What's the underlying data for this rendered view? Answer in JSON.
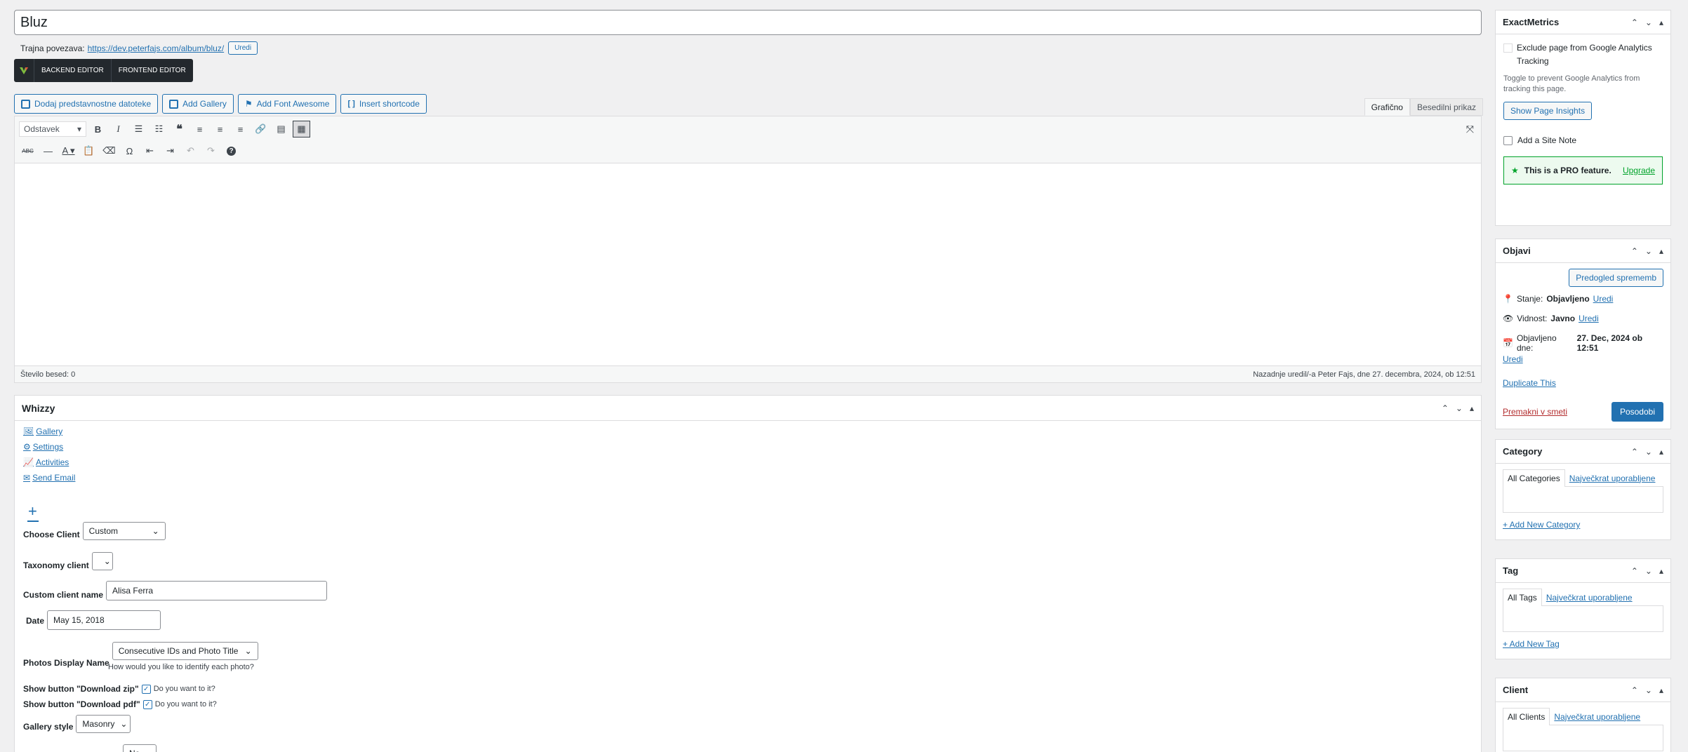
{
  "title": {
    "value": "Bluz"
  },
  "permalink": {
    "label": "Trajna povezava:",
    "url": "https://dev.peterfajs.com/album/bluz/",
    "edit": "Uredi"
  },
  "vc": {
    "backend": "BACKEND EDITOR",
    "frontend": "FRONTEND EDITOR"
  },
  "media_buttons": [
    "Dodaj predstavnostne datoteke",
    "Add Gallery",
    "Add Font Awesome",
    "Insert shortcode"
  ],
  "editor_tabs": {
    "visual": "Grafično",
    "text": "Besedilni prikaz"
  },
  "toolbar": {
    "format": "Odstavek"
  },
  "status": {
    "words": "Število besed: 0",
    "last_edit": "Nazadnje uredil/-a Peter Fajs, dne 27. decembra, 2024, ob 12:51"
  },
  "whizzy": {
    "title": "Whizzy",
    "links": [
      "Gallery",
      "Settings",
      "Activities",
      "Send Email"
    ],
    "plus": "+",
    "choose_client": {
      "label": "Choose Client",
      "value": "Custom"
    },
    "taxonomy_client": {
      "label": "Taxonomy client",
      "value": ""
    },
    "custom_client": {
      "label": "Custom client name",
      "value": "Alisa Ferra"
    },
    "date": {
      "label": "Date",
      "value": "May 15, 2018"
    },
    "photos_display": {
      "label": "Photos Display Name",
      "value": "Consecutive IDs and Photo Title",
      "hint": "How would you like to identify each photo?"
    },
    "download_zip": {
      "label": "Show button \"Download zip\"",
      "hint": "Do you want to it?"
    },
    "download_pdf": {
      "label": "Show button \"Download pdf\"",
      "hint": "Do you want to it?"
    },
    "gallery_style": {
      "label": "Gallery style",
      "value": "Masonry"
    },
    "partial_select": "No"
  },
  "exactmetrics": {
    "title": "ExactMetrics",
    "exclude": "Exclude page from Google Analytics Tracking",
    "toggle_desc": "Toggle to prevent Google Analytics from tracking this page.",
    "insights": "Show Page Insights",
    "site_note": "Add a Site Note",
    "pro": "This is a PRO feature.",
    "upgrade": "Upgrade"
  },
  "publish": {
    "title": "Objavi",
    "preview": "Predogled sprememb",
    "status_label": "Stanje:",
    "status_value": "Objavljeno",
    "status_edit": "Uredi",
    "visibility_label": "Vidnost:",
    "visibility_value": "Javno",
    "visibility_edit": "Uredi",
    "published_label": "Objavljeno dne:",
    "published_value": "27. Dec, 2024 ob 12:51",
    "published_edit": "Uredi",
    "duplicate": "Duplicate This",
    "trash": "Premakni v smeti",
    "update": "Posodobi"
  },
  "category": {
    "title": "Category",
    "tab_all": "All Categories",
    "tab_popular": "Največkrat uporabljene",
    "add": "+ Add New Category"
  },
  "tag": {
    "title": "Tag",
    "tab_all": "All Tags",
    "tab_popular": "Največkrat uporabljene",
    "add": "+ Add New Tag"
  },
  "client": {
    "title": "Client",
    "tab_all": "All Clients",
    "tab_popular": "Največkrat uporabljene"
  },
  "icons": {
    "controls": [
      "chevron-up-icon",
      "chevron-down-icon",
      "triangle-up-icon"
    ]
  }
}
